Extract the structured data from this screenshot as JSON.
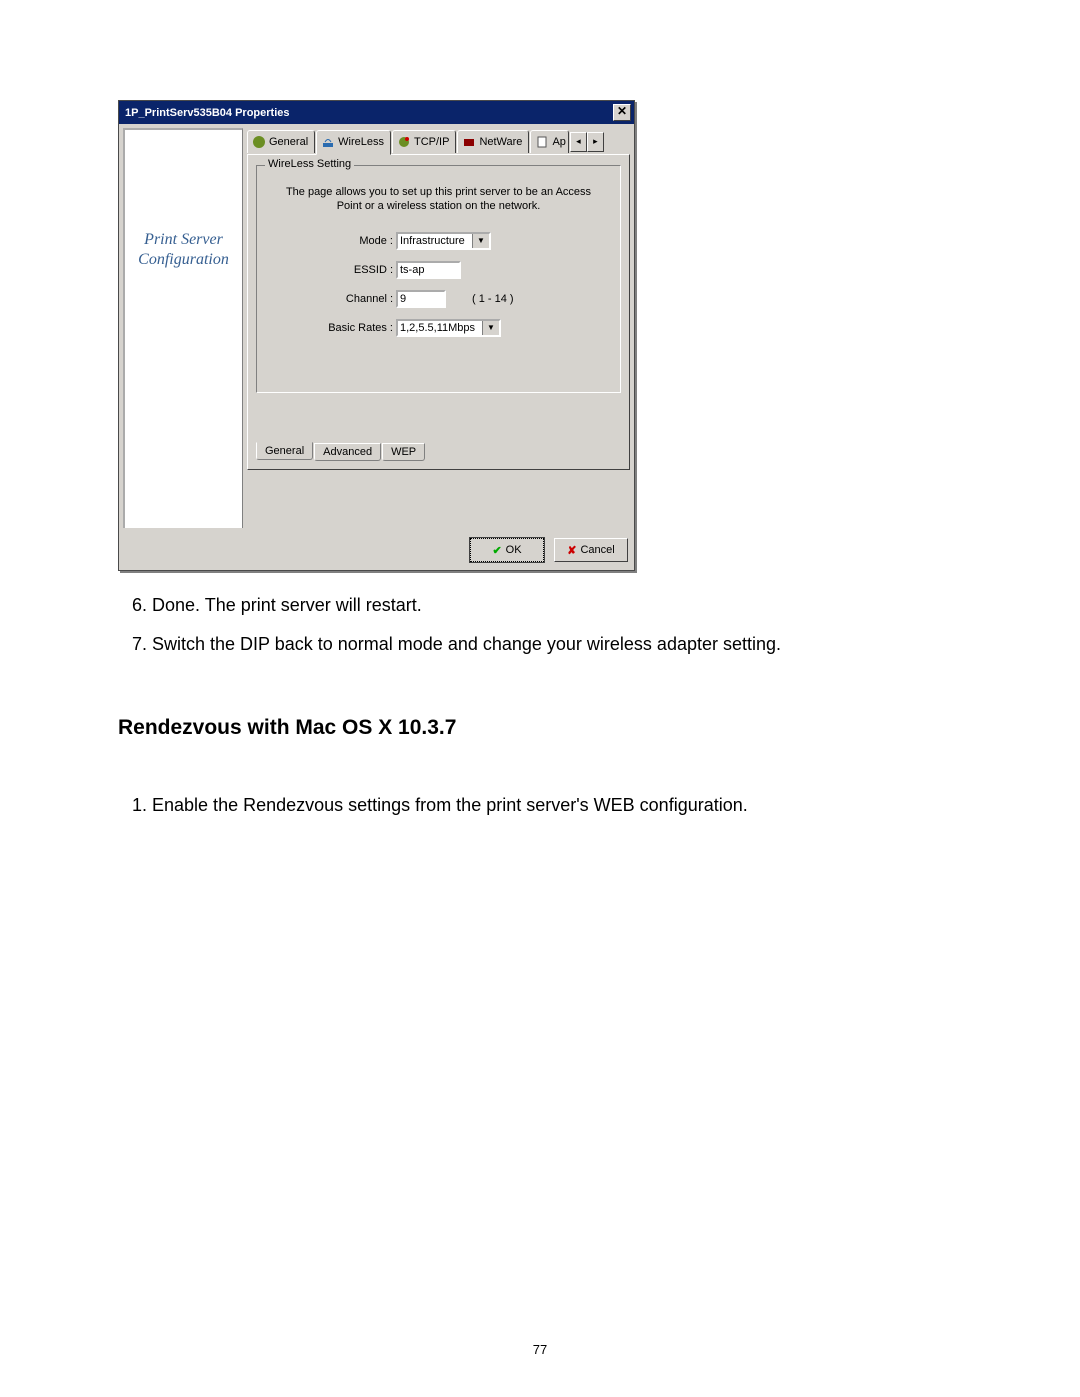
{
  "dialog": {
    "title": "1P_PrintServ535B04 Properties",
    "close_glyph": "✕",
    "sidebar": {
      "line1": "Print Server",
      "line2": "Configuration"
    },
    "tabs_top": {
      "general": "General",
      "wireless": "WireLess",
      "tcpip": "TCP/IP",
      "netware": "NetWare",
      "apple": "Ap",
      "scroll_left": "◂",
      "scroll_right": "▸"
    },
    "group": {
      "legend": "WireLess Setting",
      "hint": "The page allows you to set up this print server to be an Access Point or a wireless station on the network.",
      "mode_label": "Mode :",
      "mode_value": "Infrastructure",
      "essid_label": "ESSID :",
      "essid_value": "ts-ap",
      "channel_label": "Channel :",
      "channel_value": "9",
      "channel_range": "( 1 - 14 )",
      "rates_label": "Basic Rates :",
      "rates_value": "1,2,5.5,11Mbps"
    },
    "sub_tabs": {
      "general": "General",
      "advanced": "Advanced",
      "wep": "WEP"
    },
    "buttons": {
      "ok": "OK",
      "cancel": "Cancel"
    }
  },
  "doc": {
    "step6": "6.  Done. The print server will restart.",
    "step7": "7.  Switch the DIP back to normal mode and change your wireless adapter setting.",
    "heading": "Rendezvous with Mac OS X 10.3.7",
    "step1": "1.  Enable the Rendezvous settings from the print server's WEB configuration.",
    "page_no": "77"
  }
}
